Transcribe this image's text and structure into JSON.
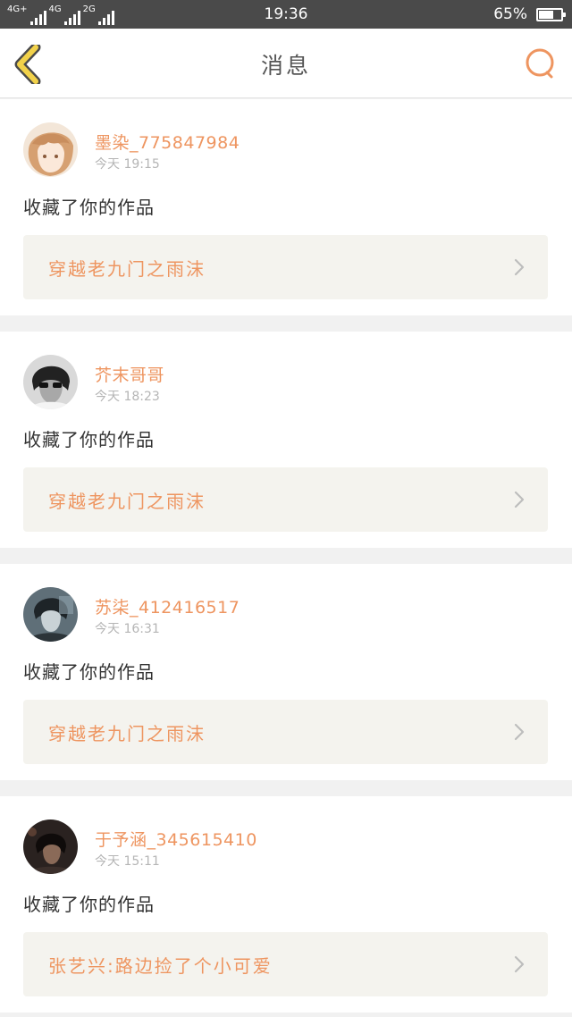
{
  "status_bar": {
    "network_left": "4G+",
    "network_mid": "4G",
    "network_right": "2G",
    "time": "19:36",
    "battery_percent": "65%",
    "battery_level": 0.65
  },
  "header": {
    "title": "消息",
    "back_icon": "chevron-left-icon",
    "search_icon": "search-icon"
  },
  "colors": {
    "accent": "#ee9560",
    "back_icon_fill": "#f2d24a",
    "card_bg": "#f4f3ee"
  },
  "messages": [
    {
      "username": "墨染_775847984",
      "time": "今天 19:15",
      "action": "收藏了你的作品",
      "work_title": "穿越老九门之雨沫"
    },
    {
      "username": "芥末哥哥",
      "time": "今天 18:23",
      "action": "收藏了你的作品",
      "work_title": "穿越老九门之雨沫"
    },
    {
      "username": "苏柒_412416517",
      "time": "今天 16:31",
      "action": "收藏了你的作品",
      "work_title": "穿越老九门之雨沫"
    },
    {
      "username": "于予涵_345615410",
      "time": "今天 15:11",
      "action": "收藏了你的作品",
      "work_title": "张艺兴:路边捡了个小可爱"
    }
  ]
}
